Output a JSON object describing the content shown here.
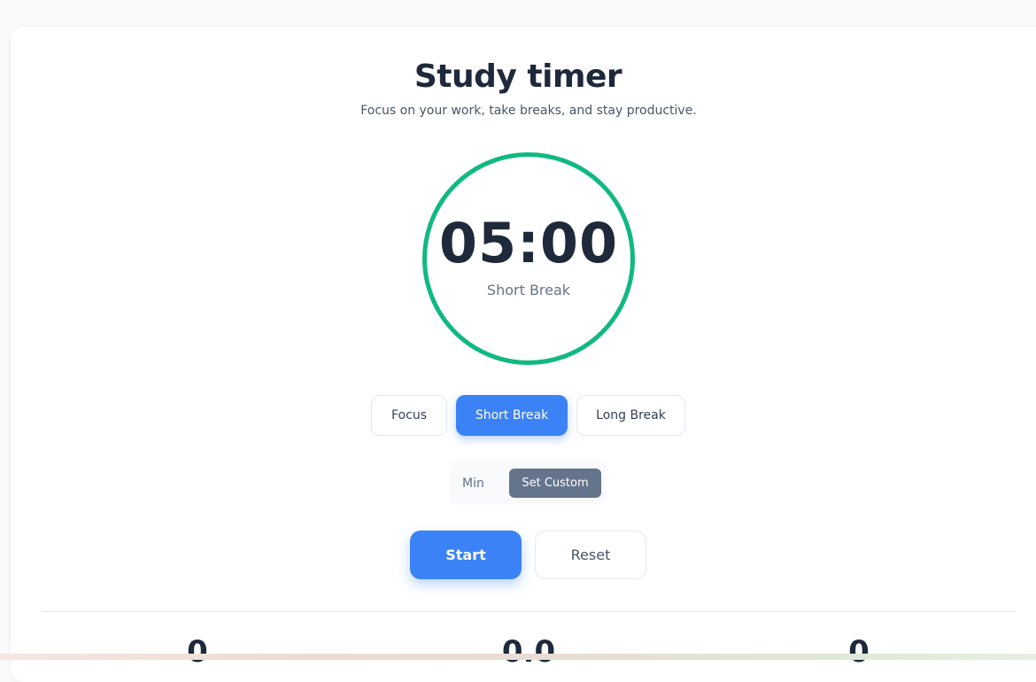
{
  "header": {
    "title": "Study timer",
    "subtitle": "Focus on your work, take breaks, and stay productive."
  },
  "timer": {
    "time": "05:00",
    "mode_label": "Short Break",
    "ring_color": "#10b981"
  },
  "modes": [
    {
      "label": "Focus",
      "active": false
    },
    {
      "label": "Short Break",
      "active": true
    },
    {
      "label": "Long Break",
      "active": false
    }
  ],
  "custom": {
    "placeholder": "Min",
    "button_label": "Set Custom"
  },
  "actions": {
    "start_label": "Start",
    "reset_label": "Reset"
  },
  "stats": {
    "sessions": "0",
    "hours": "0.0",
    "streak": "0"
  },
  "colors": {
    "accent": "#3b82f6",
    "secondary": "#64748b",
    "text": "#1e293b"
  }
}
